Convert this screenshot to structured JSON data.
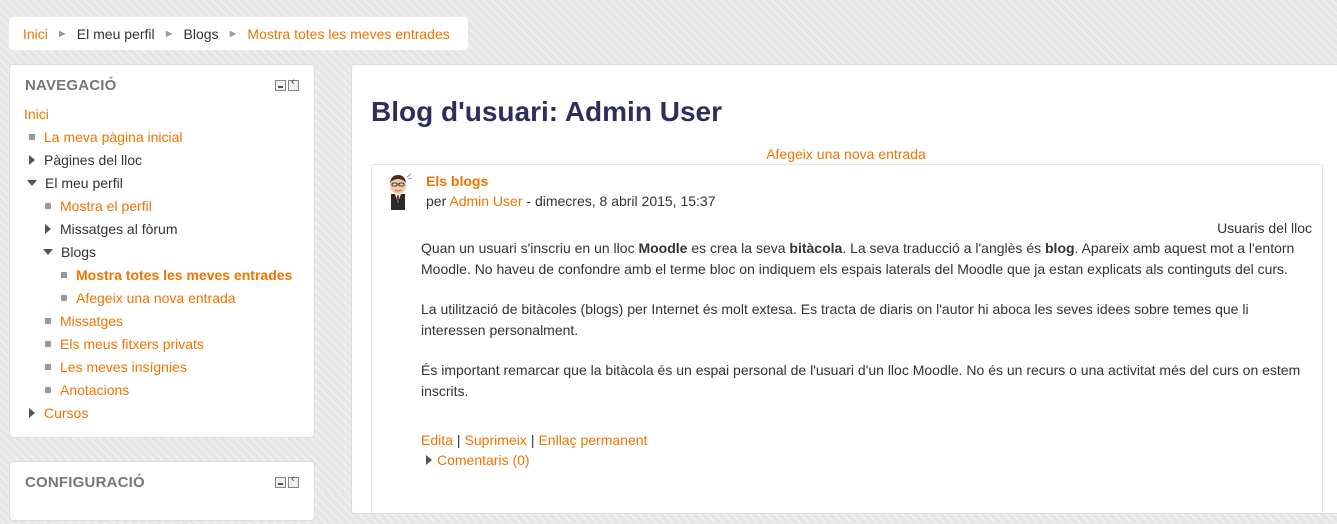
{
  "breadcrumb": {
    "items": [
      "Inici",
      "El meu perfil",
      "Blogs",
      "Mostra totes les meves entrades"
    ],
    "separator": "►"
  },
  "navigation": {
    "title": "NAVEGACIÓ",
    "items": [
      "Inici",
      "La meva pàgina inicial",
      "Pàgines del lloc",
      "El meu perfil",
      "Mostra el perfil",
      "Missatges al fòrum",
      "Blogs",
      "Mostra totes les meves entrades",
      "Afegeix una nova entrada",
      "Missatges",
      "Els meus fitxers privats",
      "Les meves insígnies",
      "Anotacions",
      "Cursos"
    ]
  },
  "configuration": {
    "title": "CONFIGURACIÓ"
  },
  "main": {
    "title": "Blog d'usuari: Admin User",
    "add_entry": "Afegeix una nova entrada",
    "entry": {
      "title": "Els blogs",
      "by": "per",
      "author": "Admin User",
      "date": " - dimecres, 8 abril 2015, 15:37",
      "association": "Usuaris del lloc",
      "p1_a": "Quan un usuari s'inscriu en un lloc ",
      "p1_b": "Moodle",
      "p1_c": " es crea la seva ",
      "p1_d": "bitàcola",
      "p1_e": ". La seva traducció a l'anglès és ",
      "p1_f": "blog",
      "p1_g": ". Apareix amb aquest mot a l'entorn Moodle. No haveu de confondre amb el terme bloc on indiquem els espais laterals del Moodle que ja estan explicats als continguts del curs.",
      "p2": "La utilització de bitàcoles (blogs) per Internet és molt extesa. Es tracta de diaris on l'autor hi aboca les seves idees sobre temes que li interessen personalment.",
      "p3": "És important remarcar que la bitàcola és un espai personal de l'usuari d'un lloc Moodle. No és un recurs o una activitat més del curs on estem inscrits.",
      "actions": {
        "edit": "Edita",
        "delete": "Suprimeix",
        "permalink": "Enllaç permanent",
        "separator": "|"
      },
      "comments": "Comentaris (0)"
    }
  },
  "colors": {
    "link": "#f07300",
    "title": "#2d2d5e",
    "text": "#333333"
  }
}
